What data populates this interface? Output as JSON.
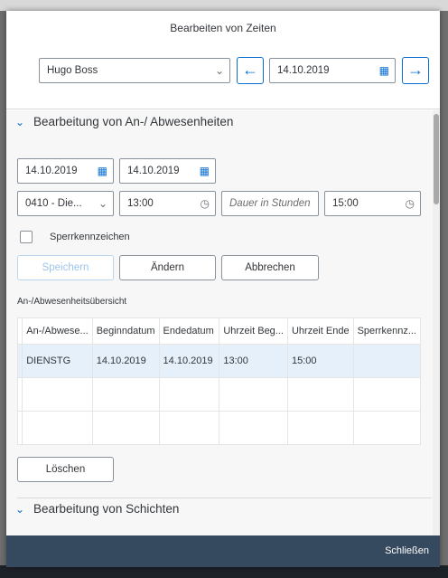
{
  "dialog": {
    "title": "Bearbeiten von Zeiten",
    "close_label": "Schließen"
  },
  "header": {
    "employee_value": "Hugo Boss",
    "date_value": "14.10.2019"
  },
  "absence_section": {
    "title": "Bearbeitung von An-/ Abwesenheiten",
    "date_from": "14.10.2019",
    "date_to": "14.10.2019",
    "type_value": "0410 - Die...",
    "time_from": "13:00",
    "duration_placeholder": "Dauer in Stunden",
    "time_to": "15:00",
    "lock_label": "Sperrkennzeichen",
    "buttons": {
      "save": "Speichern",
      "change": "Ändern",
      "cancel": "Abbrechen"
    },
    "overview_label": "An-/Abwesenheitsübersicht",
    "table": {
      "columns": [
        "An-/Abwese...",
        "Beginndatum",
        "Endedatum",
        "Uhrzeit Beg...",
        "Uhrzeit Ende",
        "Sperrkennz..."
      ],
      "rows": [
        [
          "DIENSTG",
          "14.10.2019",
          "14.10.2019",
          "13:00",
          "15:00",
          ""
        ]
      ]
    },
    "delete_label": "Löschen"
  },
  "shift_section": {
    "title": "Bearbeitung von Schichten"
  },
  "colors": {
    "accent": "#0a6ed1",
    "footer": "#354a5f",
    "selected_row": "#e5f0fa"
  }
}
